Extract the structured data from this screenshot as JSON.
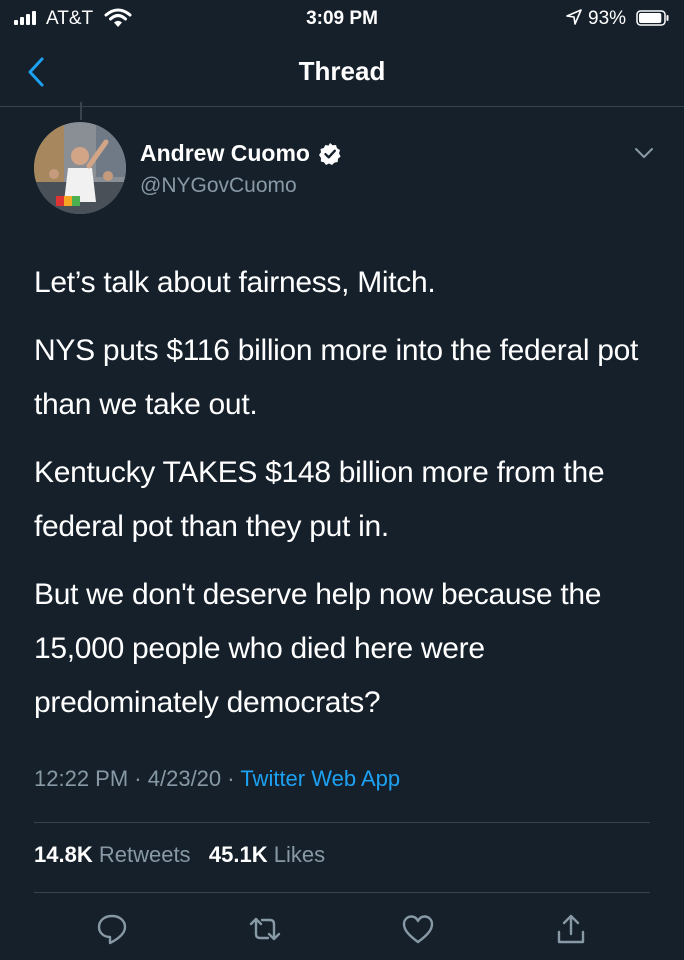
{
  "status_bar": {
    "carrier": "AT&T",
    "time": "3:09 PM",
    "battery": "93%",
    "battery_level": 0.93
  },
  "nav": {
    "title": "Thread",
    "back_icon": "chevron-left-icon"
  },
  "tweet": {
    "author_name": "Andrew Cuomo",
    "author_handle": "@NYGovCuomo",
    "verified": true,
    "paragraphs": [
      "Let’s talk about fairness, Mitch.",
      "NYS puts $116 billion more into the federal pot than we take out.",
      "Kentucky TAKES $148 billion more from the federal pot than they put in.",
      "But we don't deserve help now because the 15,000 people who died here were predominately democrats?"
    ],
    "time": "12:22 PM",
    "date": "4/23/20",
    "separator": "·",
    "source": "Twitter Web App",
    "retweets_count": "14.8K",
    "retweets_label": "Retweets",
    "likes_count": "45.1K",
    "likes_label": "Likes"
  },
  "actions": [
    "reply-icon",
    "retweet-icon",
    "like-icon",
    "share-icon"
  ],
  "colors": {
    "background": "#15202b",
    "accent": "#1da1f2",
    "secondary_text": "#8899a6",
    "divider": "#38444d"
  }
}
